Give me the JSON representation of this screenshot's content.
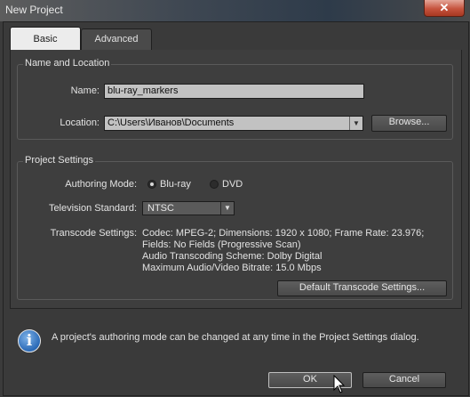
{
  "window": {
    "title": "New Project",
    "close_glyph": "✕"
  },
  "tabs": [
    {
      "label": "Basic",
      "selected": true
    },
    {
      "label": "Advanced",
      "selected": false
    }
  ],
  "name_location": {
    "group_label": "Name and Location",
    "name_label": "Name:",
    "name_value": "blu-ray_markers",
    "location_label": "Location:",
    "location_value": "C:\\Users\\Иванов\\Documents",
    "browse_label": "Browse..."
  },
  "project_settings": {
    "group_label": "Project Settings",
    "authoring_mode_label": "Authoring Mode:",
    "authoring_modes": [
      {
        "label": "Blu-ray",
        "selected": true
      },
      {
        "label": "DVD",
        "selected": false
      }
    ],
    "tv_standard_label": "Television Standard:",
    "tv_standard_value": "NTSC",
    "transcode_label": "Transcode Settings:",
    "transcode_lines": [
      "Codec: MPEG-2; Dimensions: 1920 x 1080; Frame Rate: 23.976;",
      "Fields: No Fields (Progressive Scan)",
      "Audio Transcoding Scheme: Dolby Digital",
      "Maximum Audio/Video Bitrate: 15.0 Mbps"
    ],
    "default_transcode_button": "Default Transcode Settings..."
  },
  "info": {
    "icon": "info-icon",
    "message": "A project's authoring mode can be changed at any time in the Project Settings dialog."
  },
  "buttons": {
    "ok": "OK",
    "cancel": "Cancel"
  },
  "colors": {
    "background": "#3b3b3b",
    "input_bg": "#c2c2c2",
    "close_red": "#c6533d",
    "info_blue": "#2a69b6"
  }
}
